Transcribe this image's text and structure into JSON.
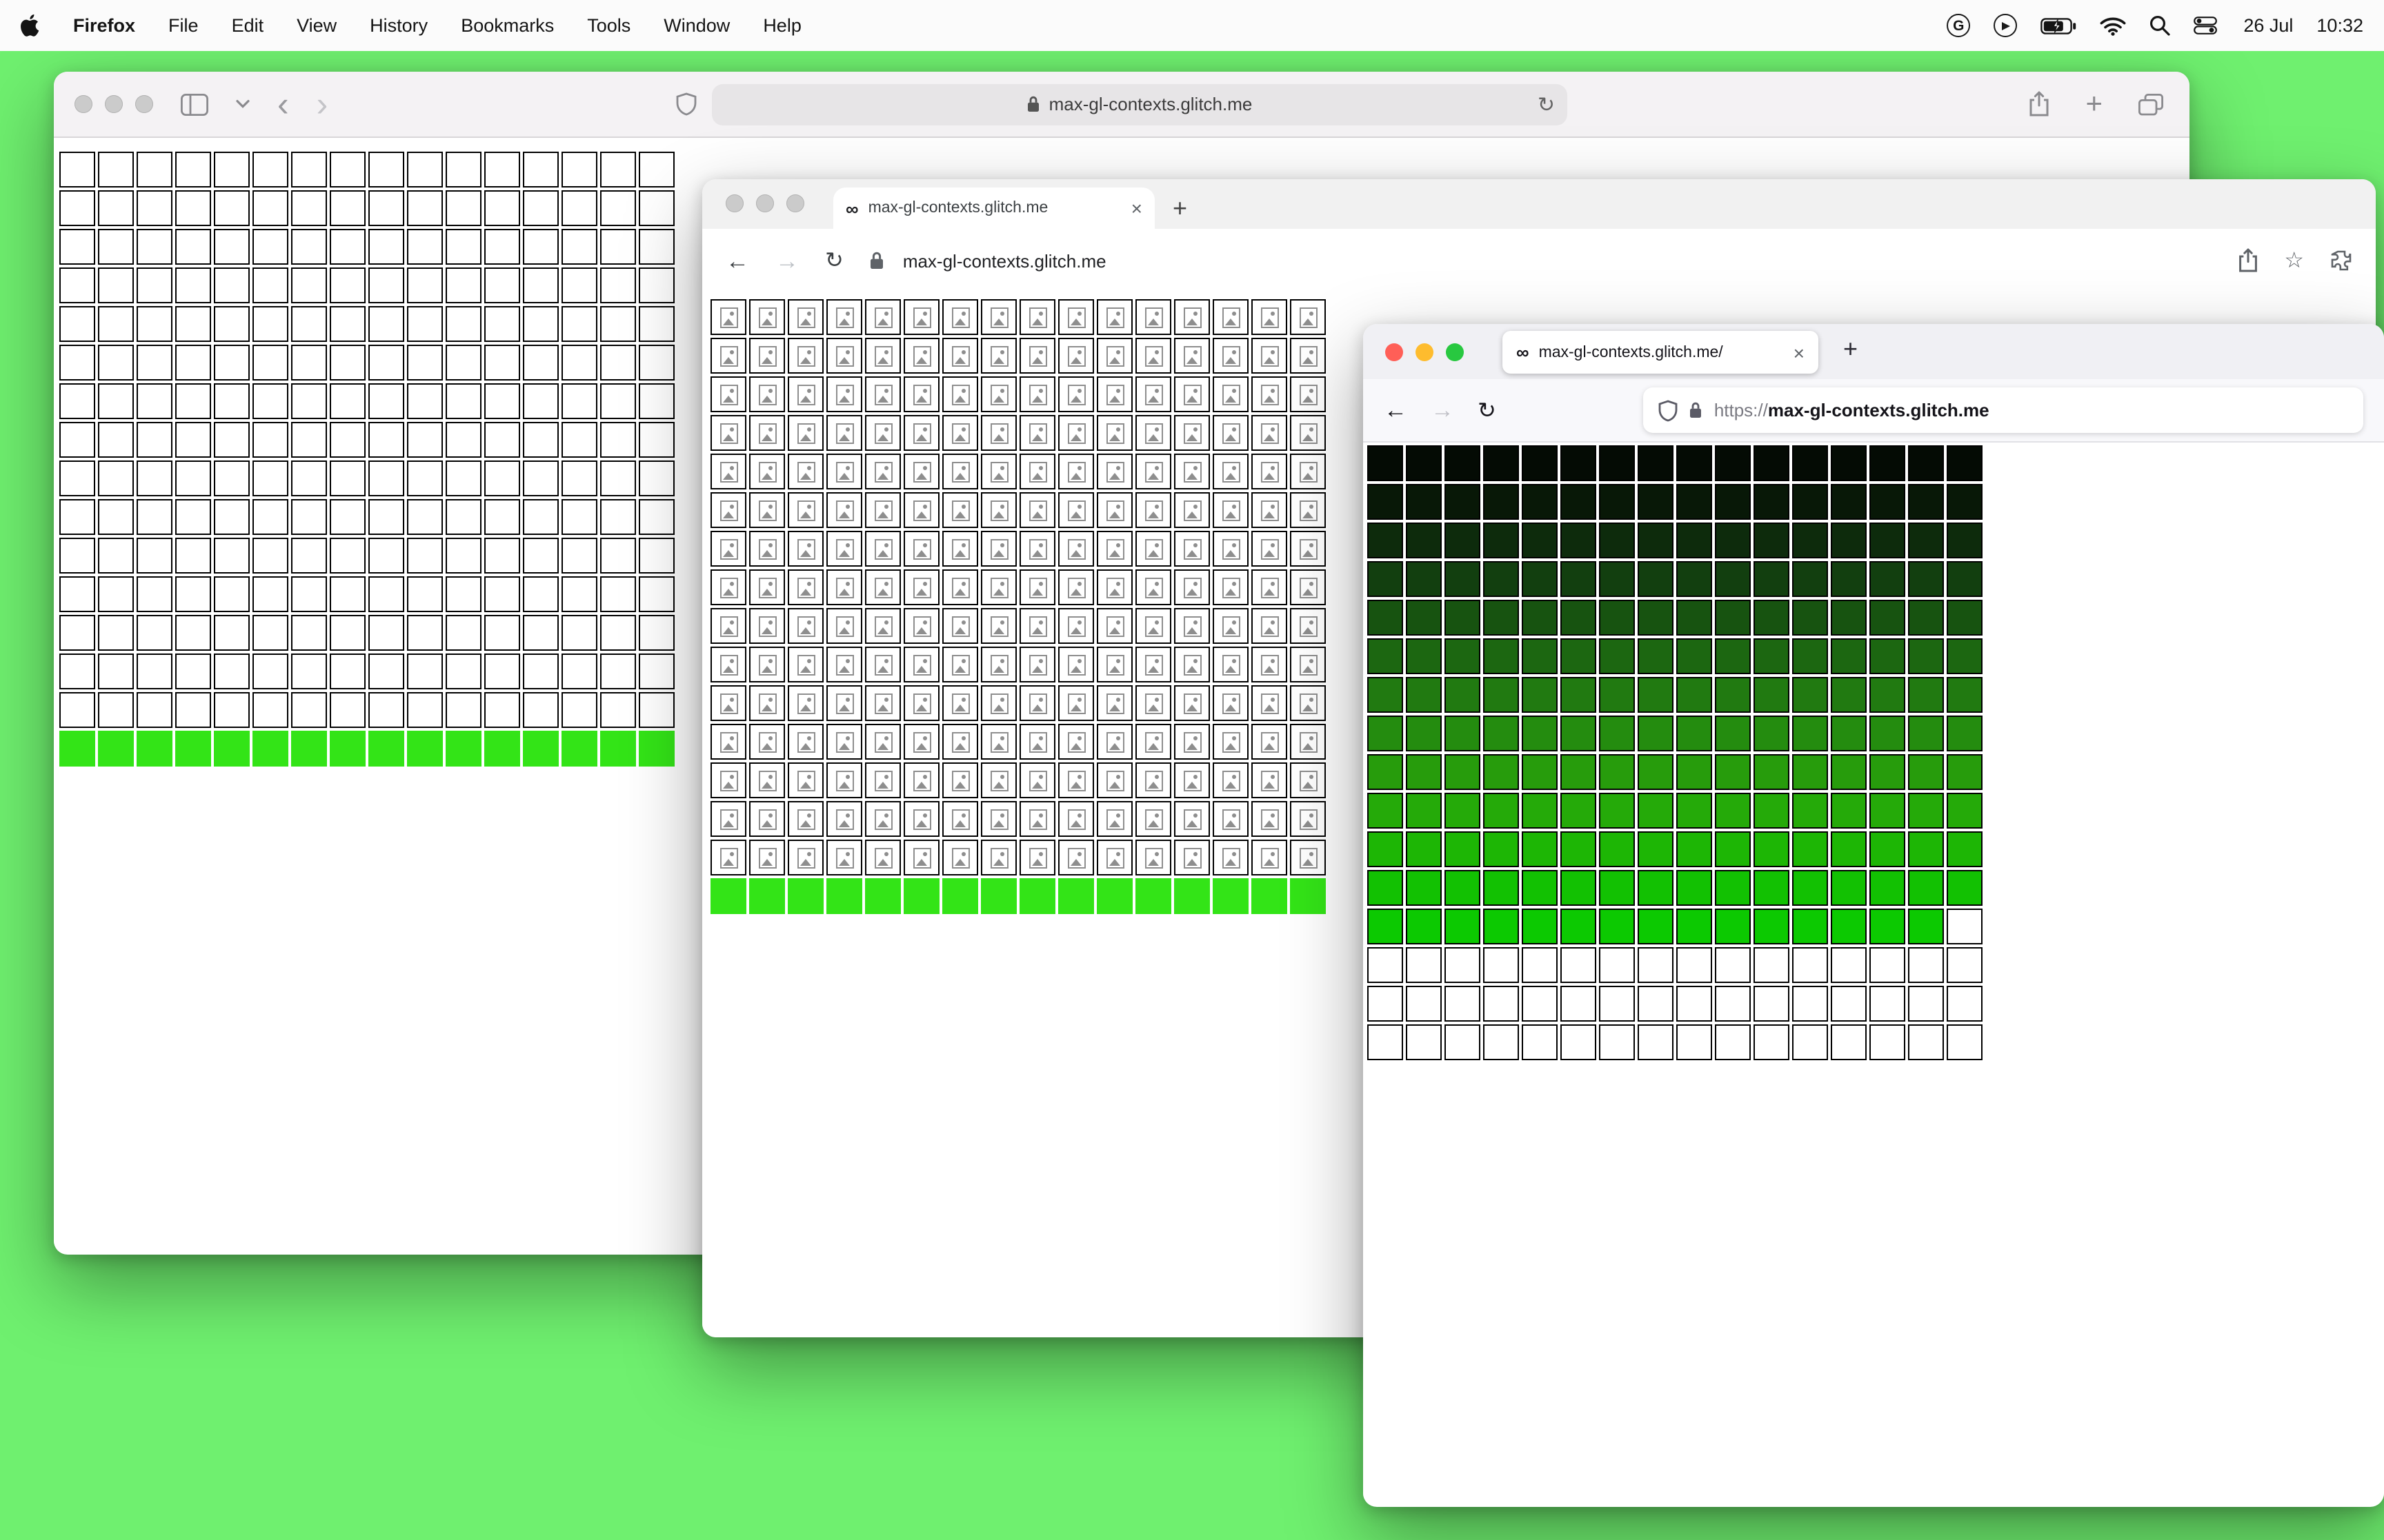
{
  "desktop": {
    "background_color": "#6ff06f"
  },
  "menu_bar": {
    "app_name": "Firefox",
    "menus": [
      "File",
      "Edit",
      "View",
      "History",
      "Bookmarks",
      "Tools",
      "Window",
      "Help"
    ],
    "date": "26 Jul",
    "time": "10:32"
  },
  "glyphs": {
    "grammarly": "G",
    "back_chevron": "‹",
    "forward_chevron": "›",
    "back_arrow": "←",
    "forward_arrow": "→",
    "reload": "↻",
    "plus": "+",
    "close": "×",
    "infinity": "∞",
    "star": "☆"
  },
  "colors": {
    "traffic_inactive": "#cbcbcb",
    "traffic_close": "#ff5f57",
    "traffic_minimize": "#febc2e",
    "traffic_zoom": "#28c840",
    "bright_green_row": "#33e417"
  },
  "safari_window": {
    "url": "max-gl-contexts.glitch.me",
    "grid": {
      "type": "uniform",
      "cols": 16,
      "rows": 16,
      "cell_color": "#ffffff",
      "bottom_row_color": "#33e417",
      "border_color": "#000000",
      "broken_icon": false
    }
  },
  "chrome_window": {
    "tab_title": "max-gl-contexts.glitch.me",
    "url": "max-gl-contexts.glitch.me",
    "grid": {
      "type": "uniform",
      "cols": 16,
      "rows": 16,
      "cell_color": "#ffffff",
      "bottom_row_color": "#33e417",
      "border_color": "#000000",
      "broken_icon": true
    }
  },
  "firefox_window": {
    "tab_title": "max-gl-contexts.glitch.me/",
    "url_scheme": "https://",
    "url_host": "max-gl-contexts.glitch.me",
    "grid": {
      "type": "gradient",
      "cols": 16,
      "rows": 16,
      "row_colors": [
        "#040b04",
        "#081807",
        "#0d2b0c",
        "#123f0f",
        "#175310",
        "#1c6711",
        "#217a11",
        "#248c0f",
        "#279c0c",
        "#25aa09",
        "#1db605",
        "#12c102"
      ],
      "partial_row_color": "#0cc901",
      "partial_row_filled": 15,
      "white_color": "#ffffff",
      "border_color": "#000000",
      "broken_icon": false
    }
  }
}
